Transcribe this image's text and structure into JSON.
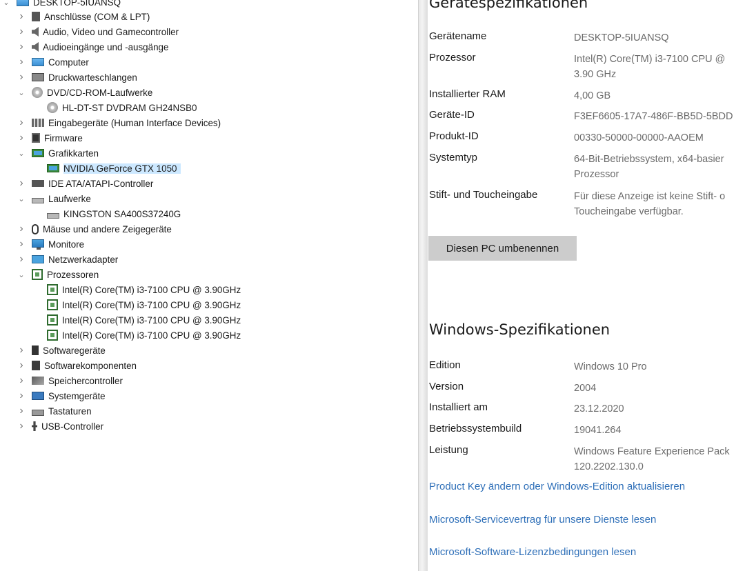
{
  "device_manager": {
    "root": "DESKTOP-5IUANSQ",
    "items": [
      {
        "label": "Anschlüsse (COM & LPT)",
        "icon": "port-icon",
        "expanded": false
      },
      {
        "label": "Audio, Video und Gamecontroller",
        "icon": "speaker-icon",
        "expanded": false
      },
      {
        "label": "Audioeingänge und -ausgänge",
        "icon": "speaker-icon",
        "expanded": false
      },
      {
        "label": "Computer",
        "icon": "computer-icon",
        "expanded": false
      },
      {
        "label": "Druckwarteschlangen",
        "icon": "printer-icon",
        "expanded": false
      },
      {
        "label": "DVD/CD-ROM-Laufwerke",
        "icon": "cd-drive-icon",
        "expanded": true
      },
      {
        "label": "HL-DT-ST DVDRAM GH24NSB0",
        "icon": "cd-drive-icon",
        "child": true
      },
      {
        "label": "Eingabegeräte (Human Interface Devices)",
        "icon": "hid-icon",
        "expanded": false
      },
      {
        "label": "Firmware",
        "icon": "firmware-icon",
        "expanded": false
      },
      {
        "label": "Grafikkarten",
        "icon": "display-adapter-icon",
        "expanded": true
      },
      {
        "label": "NVIDIA GeForce GTX 1050",
        "icon": "display-adapter-icon",
        "child": true,
        "selected": true
      },
      {
        "label": "IDE ATA/ATAPI-Controller",
        "icon": "ide-controller-icon",
        "expanded": false
      },
      {
        "label": "Laufwerke",
        "icon": "disk-drive-icon",
        "expanded": true
      },
      {
        "label": "KINGSTON SA400S37240G",
        "icon": "disk-drive-icon",
        "child": true
      },
      {
        "label": "Mäuse und andere Zeigegeräte",
        "icon": "mouse-icon",
        "expanded": false
      },
      {
        "label": "Monitore",
        "icon": "monitor-icon",
        "expanded": false
      },
      {
        "label": "Netzwerkadapter",
        "icon": "network-adapter-icon",
        "expanded": false
      },
      {
        "label": "Prozessoren",
        "icon": "processor-icon",
        "expanded": true
      },
      {
        "label": "Intel(R) Core(TM) i3-7100 CPU @ 3.90GHz",
        "icon": "processor-icon",
        "child": true
      },
      {
        "label": "Intel(R) Core(TM) i3-7100 CPU @ 3.90GHz",
        "icon": "processor-icon",
        "child": true
      },
      {
        "label": "Intel(R) Core(TM) i3-7100 CPU @ 3.90GHz",
        "icon": "processor-icon",
        "child": true
      },
      {
        "label": "Intel(R) Core(TM) i3-7100 CPU @ 3.90GHz",
        "icon": "processor-icon",
        "child": true
      },
      {
        "label": "Softwaregeräte",
        "icon": "software-device-icon",
        "expanded": false
      },
      {
        "label": "Softwarekomponenten",
        "icon": "software-component-icon",
        "expanded": false
      },
      {
        "label": "Speichercontroller",
        "icon": "storage-controller-icon",
        "expanded": false
      },
      {
        "label": "Systemgeräte",
        "icon": "system-device-icon",
        "expanded": false
      },
      {
        "label": "Tastaturen",
        "icon": "keyboard-icon",
        "expanded": false
      },
      {
        "label": "USB-Controller",
        "icon": "usb-icon",
        "expanded": false
      }
    ]
  },
  "about": {
    "device_specs_title": "Gerätespezifikationen",
    "device_specs": [
      {
        "label": "Gerätename",
        "value": [
          "DESKTOP-5IUANSQ"
        ]
      },
      {
        "label": "Prozessor",
        "value": [
          "Intel(R) Core(TM) i3-7100 CPU @",
          "3.90 GHz"
        ]
      },
      {
        "label": "Installierter RAM",
        "value": [
          "4,00 GB"
        ]
      },
      {
        "label": "Geräte-ID",
        "value": [
          "F3EF6605-17A7-486F-BB5D-5BDD"
        ]
      },
      {
        "label": "Produkt-ID",
        "value": [
          "00330-50000-00000-AAOEM"
        ]
      },
      {
        "label": "Systemtyp",
        "value": [
          "64-Bit-Betriebssystem, x64-basier",
          "Prozessor"
        ]
      },
      {
        "label": "Stift- und Toucheingabe",
        "value": [
          "Für diese Anzeige ist keine Stift- o",
          "Toucheingabe verfügbar."
        ]
      }
    ],
    "rename_button": "Diesen PC umbenennen",
    "windows_specs_title": "Windows-Spezifikationen",
    "windows_specs": [
      {
        "label": "Edition",
        "value": [
          "Windows 10 Pro"
        ]
      },
      {
        "label": "Version",
        "value": [
          "2004"
        ]
      },
      {
        "label": "Installiert am",
        "value": [
          "23.12.2020"
        ]
      },
      {
        "label": "Betriebssystembuild",
        "value": [
          "19041.264"
        ]
      },
      {
        "label": "Leistung",
        "value": [
          "Windows Feature Experience Pack",
          "120.2202.130.0"
        ]
      }
    ],
    "links": [
      "Product Key ändern oder Windows-Edition aktualisieren",
      "Microsoft-Servicevertrag für unsere Dienste lesen",
      "Microsoft-Software-Lizenzbedingungen lesen"
    ]
  },
  "colors": {
    "link": "#2e6fb8",
    "selection": "#cce8ff",
    "button": "#cccccc",
    "value_gray": "#6b6b6b"
  }
}
